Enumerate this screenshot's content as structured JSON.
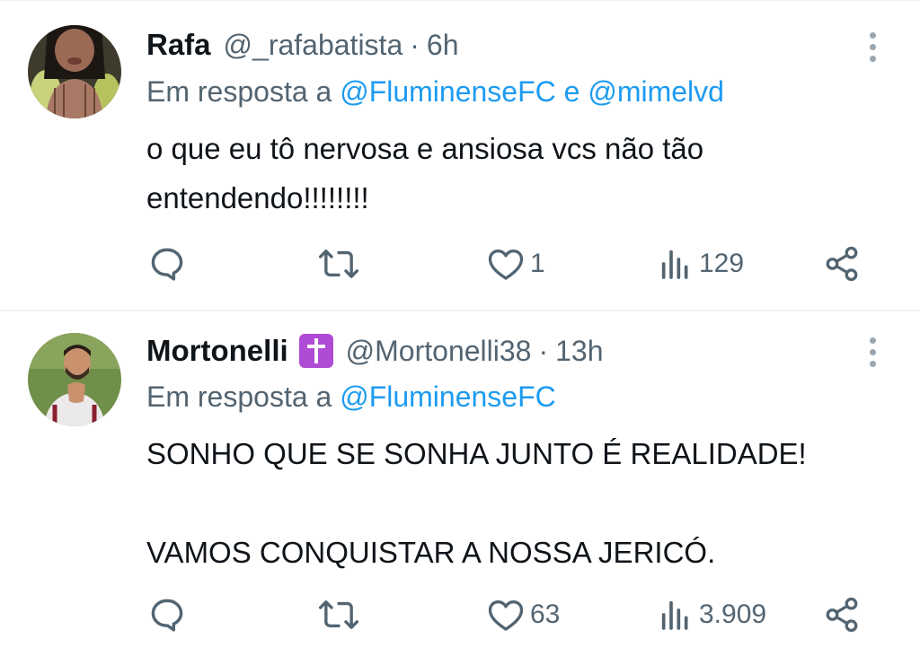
{
  "tweets": [
    {
      "name": "Rafa",
      "has_badge": false,
      "handle": "@_rafabatista",
      "separator": "·",
      "time": "6h",
      "reply_prefix": "Em resposta a",
      "reply_mention_1": "@FluminenseFC",
      "reply_conj": "e",
      "reply_mention_2": "@mimelvd",
      "text": "o que eu tô nervosa e ansiosa vcs não tão\nentendendo!!!!!!!!",
      "likes": "1",
      "views": "129"
    },
    {
      "name": "Mortonelli",
      "has_badge": true,
      "badge_icon": "latin-cross-emoji",
      "handle": "@Mortonelli38",
      "separator": "·",
      "time": "13h",
      "reply_prefix": "Em resposta a",
      "reply_mention_1": "@FluminenseFC",
      "text": "SONHO QUE SE SONHA JUNTO É REALIDADE!\n\nVAMOS CONQUISTAR A NOSSA JERICÓ.",
      "likes": "63",
      "views": "3.909"
    }
  ],
  "colors": {
    "text_primary": "#0f1419",
    "text_secondary": "#536471",
    "link": "#1d9bf0",
    "badge": "#b04bd6",
    "divider": "#eff3f4"
  },
  "icons": [
    "reply-icon",
    "retweet-icon",
    "like-icon",
    "views-icon",
    "share-icon",
    "more-options-icon"
  ]
}
